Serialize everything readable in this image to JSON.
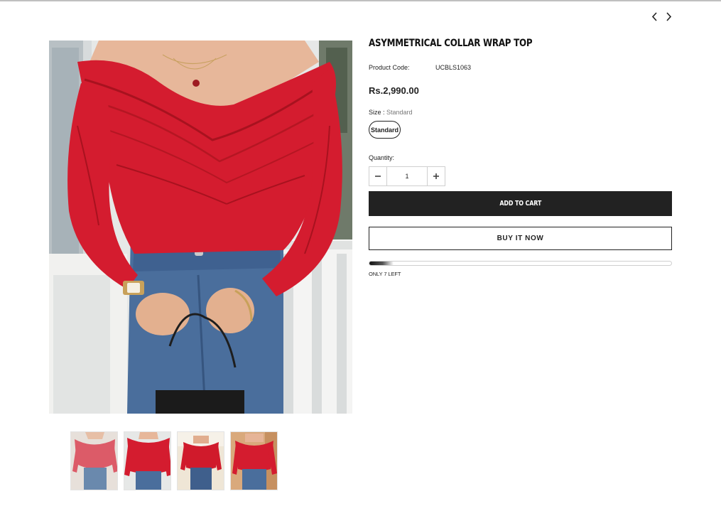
{
  "nav": {
    "prev_icon": "chevron-left-icon",
    "next_icon": "chevron-right-icon"
  },
  "product": {
    "title": "ASYMMETRICAL COLLAR WRAP TOP",
    "code_label": "Product Code:",
    "code_value": "UCBLS1063",
    "price": "Rs.2,990.00",
    "size_label": "Size : ",
    "size_value": "Standard",
    "size_options": [
      "Standard"
    ],
    "quantity_label": "Quantity:",
    "quantity_value": "1",
    "add_to_cart_label": "ADD TO CART",
    "buy_now_label": "BUY IT NOW",
    "stock_text": "ONLY 7 LEFT",
    "stock_level_percent": 8
  },
  "gallery": {
    "main_image": "red off-shoulder wrap top with blue jeans",
    "thumbnail_count": 4
  },
  "colors": {
    "accent": "#222222",
    "product_red": "#d41c2f"
  }
}
